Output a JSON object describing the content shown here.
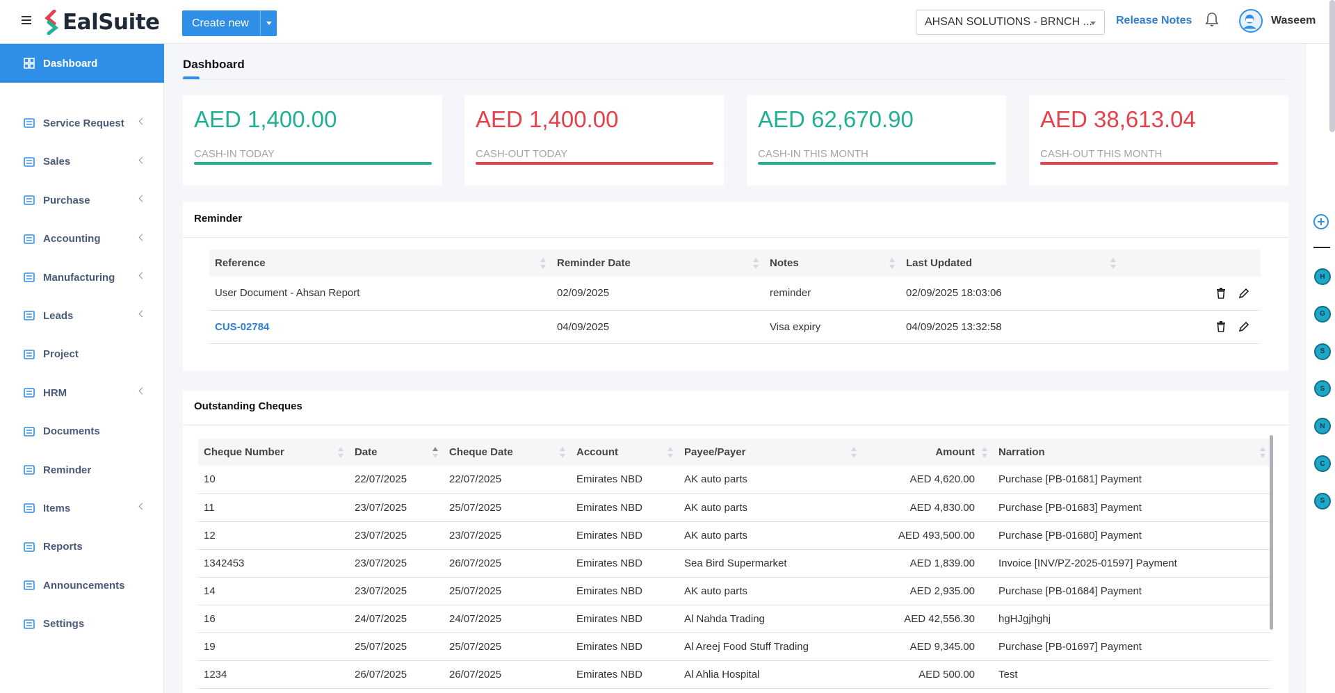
{
  "header": {
    "brand": "EalSuite",
    "create_label": "Create new",
    "company": "AHSAN SOLUTIONS - BRNCH ...",
    "release_notes": "Release Notes",
    "user_name": "Waseem"
  },
  "sidebar": {
    "items": [
      {
        "label": "Dashboard",
        "icon": "dashboard-icon",
        "active": true,
        "chevron": false
      },
      {
        "label": "Service Request",
        "icon": "service-request-icon",
        "chevron": true
      },
      {
        "label": "Sales",
        "icon": "sales-icon",
        "chevron": true
      },
      {
        "label": "Purchase",
        "icon": "purchase-icon",
        "chevron": true
      },
      {
        "label": "Accounting",
        "icon": "accounting-icon",
        "chevron": true
      },
      {
        "label": "Manufacturing",
        "icon": "manufacturing-icon",
        "chevron": true
      },
      {
        "label": "Leads",
        "icon": "leads-icon",
        "chevron": true
      },
      {
        "label": "Project",
        "icon": "project-icon",
        "chevron": false
      },
      {
        "label": "HRM",
        "icon": "hrm-icon",
        "chevron": true
      },
      {
        "label": "Documents",
        "icon": "documents-icon",
        "chevron": false
      },
      {
        "label": "Reminder",
        "icon": "reminder-icon",
        "chevron": false
      },
      {
        "label": "Items",
        "icon": "items-icon",
        "chevron": true
      },
      {
        "label": "Reports",
        "icon": "reports-icon",
        "chevron": false
      },
      {
        "label": "Announcements",
        "icon": "announcements-icon",
        "chevron": false
      },
      {
        "label": "Settings",
        "icon": "settings-icon",
        "chevron": false
      }
    ]
  },
  "page": {
    "title": "Dashboard"
  },
  "stats": [
    {
      "value": "AED 1,400.00",
      "label": "CASH-IN TODAY",
      "tone": "green"
    },
    {
      "value": "AED 1,400.00",
      "label": "CASH-OUT TODAY",
      "tone": "red"
    },
    {
      "value": "AED 62,670.90",
      "label": "CASH-IN THIS MONTH",
      "tone": "green"
    },
    {
      "value": "AED 38,613.04",
      "label": "CASH-OUT THIS MONTH",
      "tone": "red"
    }
  ],
  "reminder": {
    "title": "Reminder",
    "columns": [
      "Reference",
      "Reminder Date",
      "Notes",
      "Last Updated"
    ],
    "rows": [
      {
        "reference": "User Document - Ahsan Report",
        "is_link": false,
        "date": "02/09/2025",
        "notes": "reminder",
        "updated": "02/09/2025 18:03:06"
      },
      {
        "reference": "CUS-02784",
        "is_link": true,
        "date": "04/09/2025",
        "notes": "Visa expiry",
        "updated": "04/09/2025 13:32:58"
      }
    ]
  },
  "cheques": {
    "title": "Outstanding Cheques",
    "columns": [
      "Cheque Number",
      "Date",
      "Cheque Date",
      "Account",
      "Payee/Payer",
      "Amount",
      "Narration"
    ],
    "rows": [
      {
        "number": "10",
        "date": "22/07/2025",
        "cheque_date": "22/07/2025",
        "account": "Emirates NBD",
        "payee": "AK auto parts",
        "amount": "AED 4,620.00",
        "narration": "Purchase [PB-01681] Payment"
      },
      {
        "number": "11",
        "date": "23/07/2025",
        "cheque_date": "25/07/2025",
        "account": "Emirates NBD",
        "payee": "AK auto parts",
        "amount": "AED 4,830.00",
        "narration": "Purchase [PB-01683] Payment"
      },
      {
        "number": "12",
        "date": "23/07/2025",
        "cheque_date": "23/07/2025",
        "account": "Emirates NBD",
        "payee": "AK auto parts",
        "amount": "AED 493,500.00",
        "narration": "Purchase [PB-01680] Payment"
      },
      {
        "number": "1342453",
        "date": "23/07/2025",
        "cheque_date": "26/07/2025",
        "account": "Emirates NBD",
        "payee": "Sea Bird Supermarket",
        "amount": "AED 1,839.00",
        "narration": "Invoice [INV/PZ-2025-01597] Payment"
      },
      {
        "number": "14",
        "date": "23/07/2025",
        "cheque_date": "25/07/2025",
        "account": "Emirates NBD",
        "payee": "AK auto parts",
        "amount": "AED 2,935.00",
        "narration": "Purchase [PB-01684] Payment"
      },
      {
        "number": "16",
        "date": "24/07/2025",
        "cheque_date": "24/07/2025",
        "account": "Emirates NBD",
        "payee": "Al Nahda Trading",
        "amount": "AED 42,556.30",
        "narration": "hgHJgjhghj"
      },
      {
        "number": "19",
        "date": "25/07/2025",
        "cheque_date": "25/07/2025",
        "account": "Emirates NBD",
        "payee": "Al Areej Food Stuff Trading",
        "amount": "AED 9,345.00",
        "narration": "Purchase [PB-01697] Payment"
      },
      {
        "number": "1234",
        "date": "26/07/2025",
        "cheque_date": "26/07/2025",
        "account": "Emirates NBD",
        "payee": "Al Ahlia Hospital",
        "amount": "AED 500.00",
        "narration": "Test"
      }
    ]
  },
  "rail": {
    "letters": [
      "H",
      "G",
      "S",
      "S",
      "N",
      "C",
      "S"
    ]
  },
  "colors": {
    "accent": "#2f8ee5",
    "positive": "#22b093",
    "negative": "#e4414b"
  }
}
